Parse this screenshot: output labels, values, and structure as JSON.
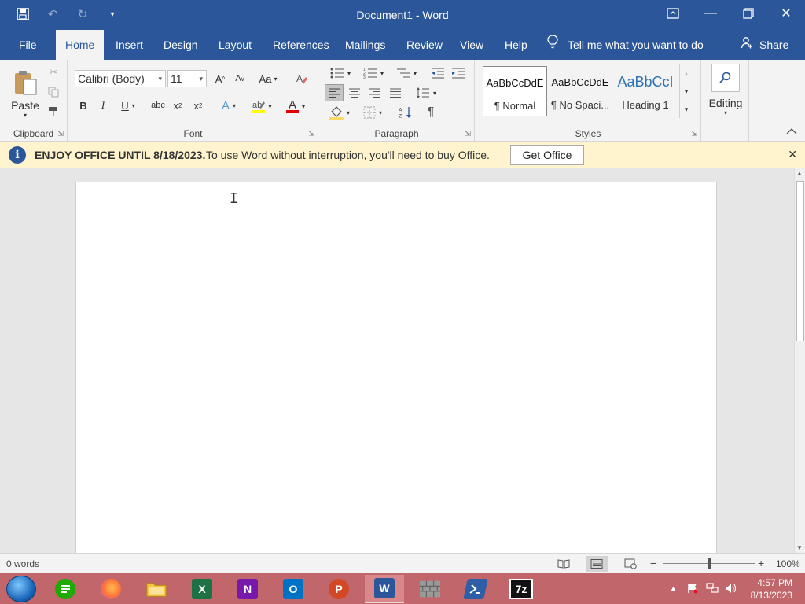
{
  "window": {
    "title": "Document1  -  Word",
    "controls": [
      "restore-ribbon",
      "minimize",
      "maximize",
      "close"
    ]
  },
  "qat": {
    "save_icon": "save-icon",
    "undo_icon": "undo-icon",
    "redo_icon": "redo-icon",
    "customize_icon": "customize-qat-icon"
  },
  "tabs": [
    {
      "label": "File"
    },
    {
      "label": "Home",
      "active": true
    },
    {
      "label": "Insert"
    },
    {
      "label": "Design"
    },
    {
      "label": "Layout"
    },
    {
      "label": "References"
    },
    {
      "label": "Mailings"
    },
    {
      "label": "Review"
    },
    {
      "label": "View"
    },
    {
      "label": "Help"
    }
  ],
  "tellme": {
    "label": "Tell me what you want to do"
  },
  "share": {
    "label": "Share"
  },
  "ribbon": {
    "clipboard": {
      "label": "Clipboard",
      "paste": "Paste"
    },
    "font": {
      "label": "Font",
      "font_name": "Calibri (Body)",
      "font_size": "11",
      "grow": "A",
      "shrink": "A",
      "change_case": "Aa",
      "bold": "B",
      "italic": "I",
      "underline": "U",
      "strike": "abc",
      "subscript": "x",
      "superscript": "x",
      "text_effects": "A",
      "font_color": "A"
    },
    "paragraph": {
      "label": "Paragraph",
      "pilcrow": "¶"
    },
    "styles": {
      "label": "Styles",
      "items": [
        {
          "sample": "AaBbCcDdE",
          "name": "¶ Normal"
        },
        {
          "sample": "AaBbCcDdE",
          "name": "¶ No Spaci..."
        },
        {
          "sample": "AaBbCcI",
          "name": "Heading 1"
        }
      ]
    },
    "editing": {
      "label": "Editing"
    }
  },
  "notice": {
    "title": "ENJOY OFFICE UNTIL 8/18/2023.",
    "message": "To use Word without interruption, you'll need to buy Office.",
    "button": "Get Office"
  },
  "status": {
    "word_count": "0 words",
    "zoom": "100%"
  },
  "taskbar": {
    "apps": [
      {
        "name": "sheets",
        "icon": "sheets-icon"
      },
      {
        "name": "firefox",
        "icon": "firefox-icon"
      },
      {
        "name": "file-explorer",
        "icon": "folder-icon"
      },
      {
        "name": "excel",
        "icon": "excel-icon",
        "letter": "X",
        "color": "#1e7145"
      },
      {
        "name": "onenote",
        "icon": "onenote-icon",
        "letter": "N",
        "color": "#7719aa"
      },
      {
        "name": "outlook",
        "icon": "outlook-icon",
        "letter": "O",
        "color": "#0072c6"
      },
      {
        "name": "powerpoint",
        "icon": "powerpoint-icon",
        "letter": "P",
        "color": "#d24726"
      },
      {
        "name": "word",
        "icon": "word-icon",
        "letter": "W",
        "color": "#2b579a",
        "active": true
      },
      {
        "name": "firewall",
        "icon": "brick-wall-icon"
      },
      {
        "name": "powershell",
        "icon": "powershell-icon"
      },
      {
        "name": "7zip",
        "icon": "7zip-icon",
        "letter": "7z"
      }
    ],
    "time": "4:57 PM",
    "date": "8/13/2023"
  },
  "colors": {
    "word_blue": "#2b579a",
    "notice_bg": "#fff4ce",
    "taskbar": "#c1666b"
  }
}
